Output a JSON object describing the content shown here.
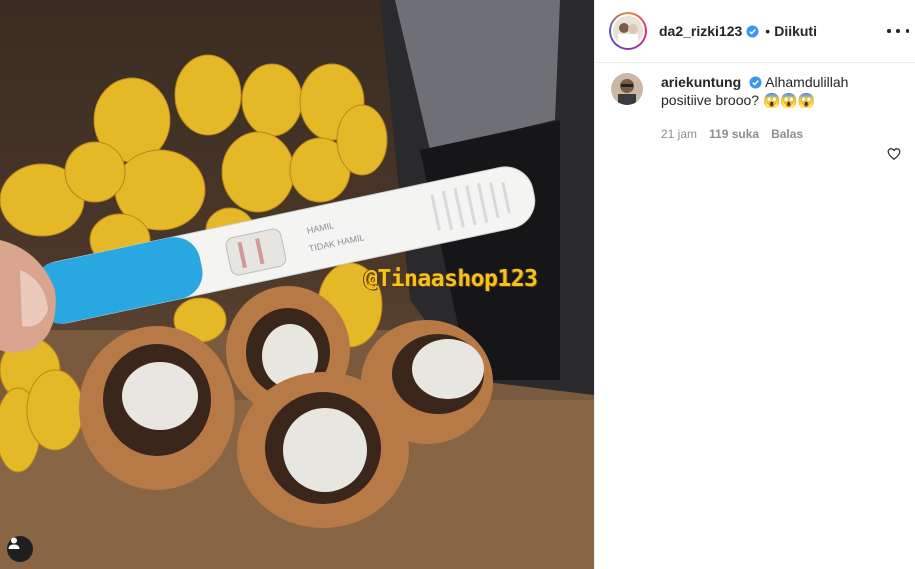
{
  "post": {
    "watermark": "@Tinaashop123",
    "test_strip_labels": [
      "HAMIL",
      "TIDAK HAMIL"
    ]
  },
  "header": {
    "username": "da2_rizki123",
    "separator": "•",
    "follow_status": "Diikuti"
  },
  "comments": [
    {
      "username": "ariekuntung",
      "text": "Alhamdulillah positiive brooo? 😱😱😱",
      "time": "21 jam",
      "likes": "119 suka",
      "reply": "Balas"
    }
  ],
  "colors": {
    "verified": "#3897f0",
    "watermark": "#f6c21c",
    "strip_handle": "#29a7e1"
  },
  "icons": [
    "user-tag-icon",
    "verified-badge-icon",
    "more-options-icon",
    "heart-outline-icon"
  ]
}
